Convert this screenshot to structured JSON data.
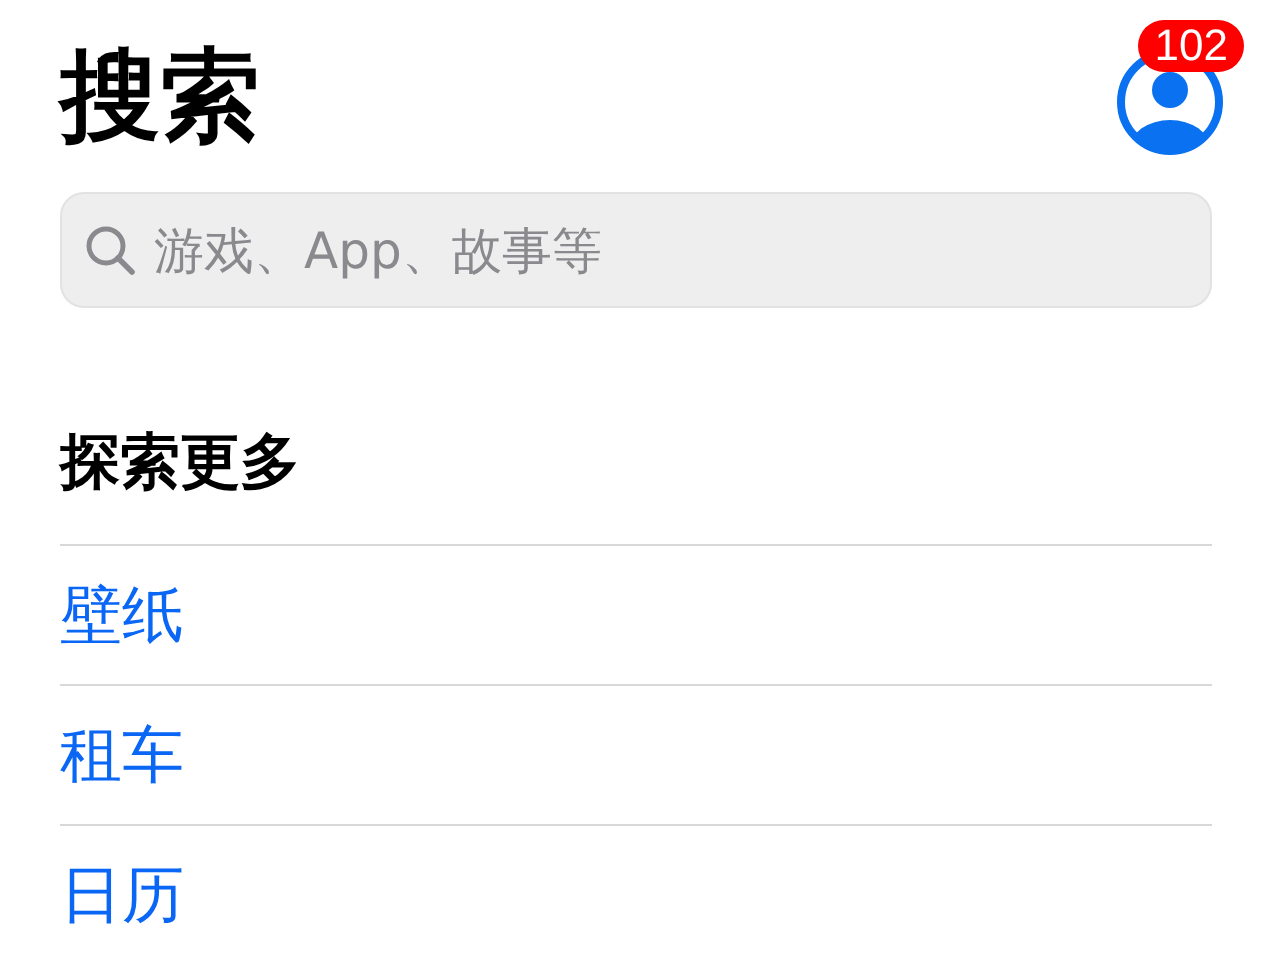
{
  "header": {
    "title": "搜索",
    "badge": "102"
  },
  "search": {
    "placeholder": "游戏、App、故事等"
  },
  "section": {
    "title": "探索更多",
    "items": [
      {
        "label": "壁纸"
      },
      {
        "label": "租车"
      },
      {
        "label": "日历"
      }
    ]
  }
}
